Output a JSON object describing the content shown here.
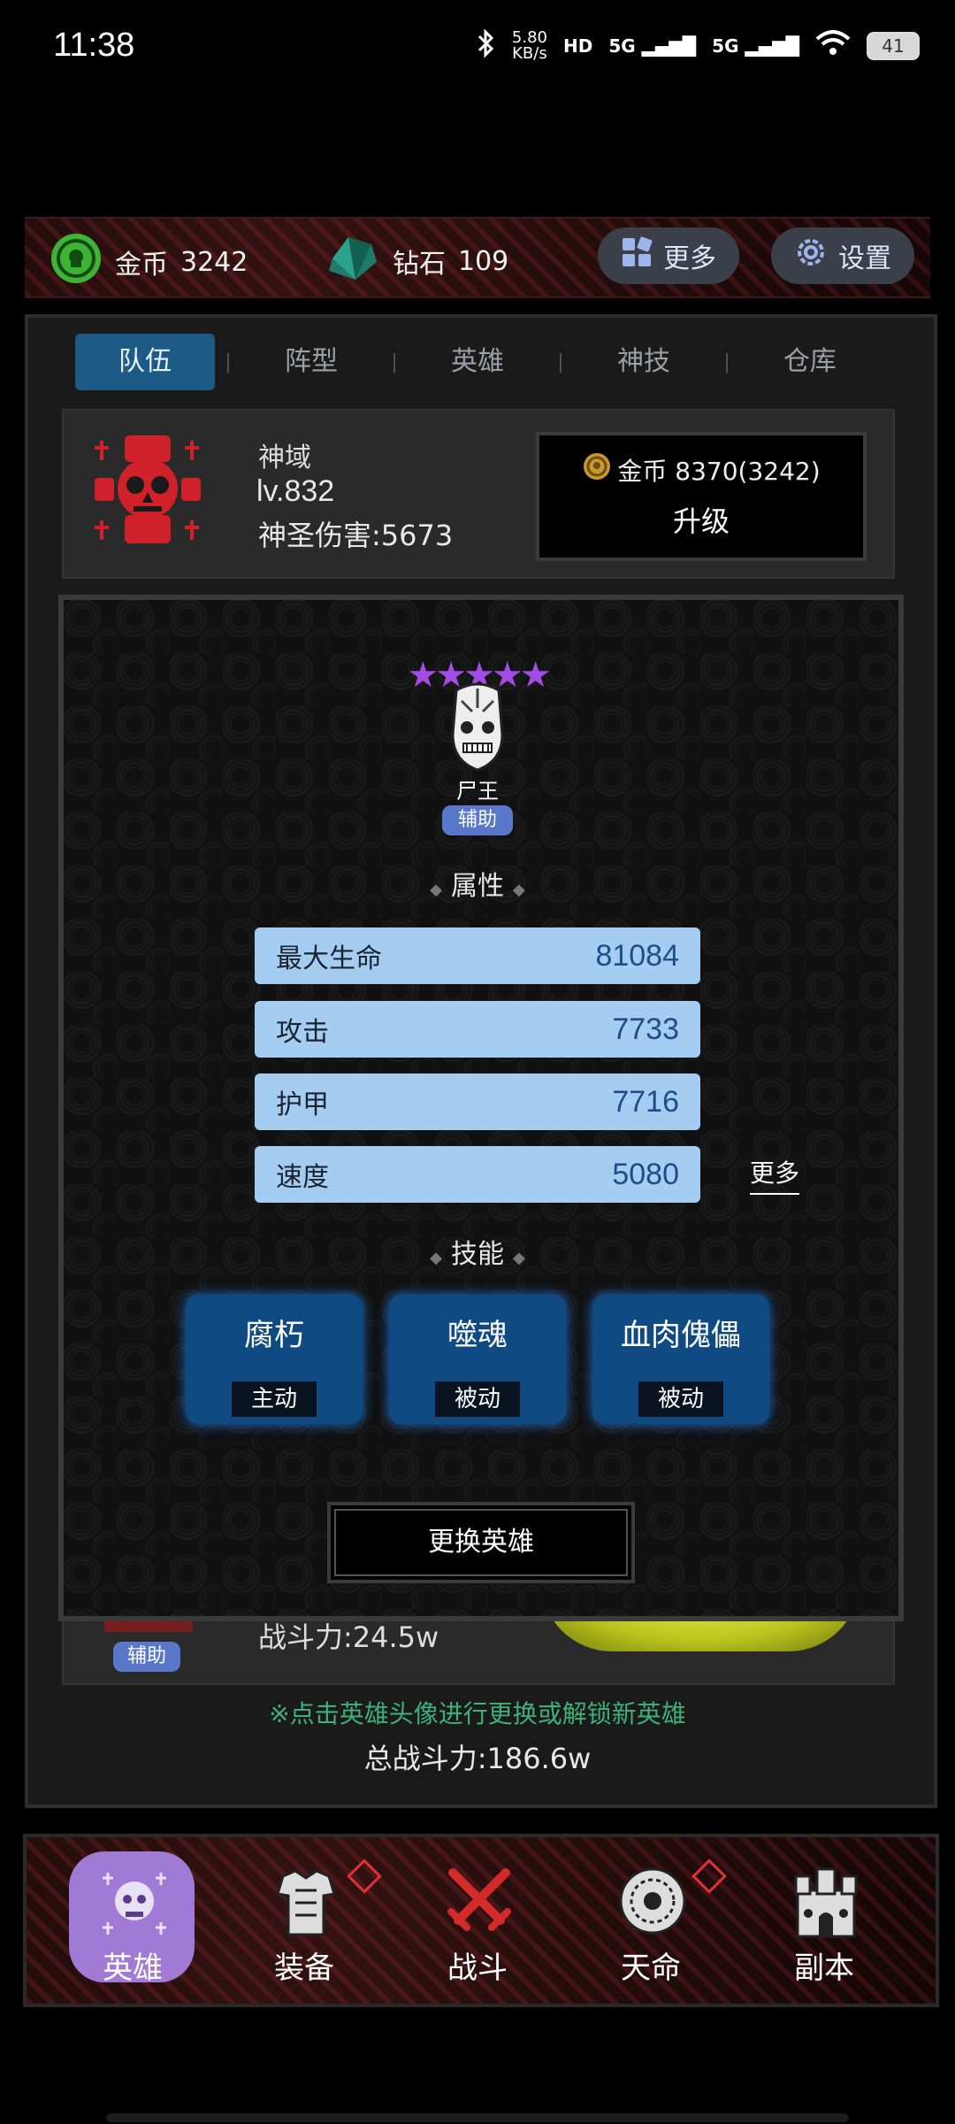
{
  "status_bar": {
    "time": "11:38",
    "net_speed_value": "5.80",
    "net_speed_unit": "KB/s",
    "hd_label": "HD",
    "sim1_label": "5G",
    "sim2_label": "5G",
    "battery": "41"
  },
  "resources": {
    "gold_label": "金币",
    "gold_value": "3242",
    "diamond_label": "钻石",
    "diamond_value": "109",
    "more_label": "更多",
    "settings_label": "设置"
  },
  "tabs": [
    {
      "label": "队伍",
      "active": true
    },
    {
      "label": "阵型",
      "active": false
    },
    {
      "label": "英雄",
      "active": false
    },
    {
      "label": "神技",
      "active": false
    },
    {
      "label": "仓库",
      "active": false
    }
  ],
  "domain": {
    "name": "神域",
    "level": "lv.832",
    "holy_damage": "神圣伤害:5673",
    "upgrade_cost": "金币 8370(3242)",
    "upgrade_label": "升级"
  },
  "hero": {
    "stars": "★★★★★",
    "star_count": 5,
    "name": "尸王",
    "role": "辅助",
    "attributes_title": "属性",
    "attributes": [
      {
        "label": "最大生命",
        "value": "81084"
      },
      {
        "label": "攻击",
        "value": "7733"
      },
      {
        "label": "护甲",
        "value": "7716"
      },
      {
        "label": "速度",
        "value": "5080"
      }
    ],
    "more_label": "更多",
    "skills_title": "技能",
    "skills": [
      {
        "name": "腐朽",
        "type": "主动"
      },
      {
        "name": "噬魂",
        "type": "被动"
      },
      {
        "name": "血肉傀儡",
        "type": "被动"
      }
    ],
    "change_hero_label": "更换英雄"
  },
  "behind_row": {
    "power": "战斗力:24.5w",
    "role": "辅助"
  },
  "hint": "※点击英雄头像进行更换或解锁新英雄",
  "total_power": "总战斗力:186.6w",
  "bottom_nav": [
    {
      "label": "英雄",
      "active": true
    },
    {
      "label": "装备",
      "active": false
    },
    {
      "label": "战斗",
      "active": false
    },
    {
      "label": "天命",
      "active": false
    },
    {
      "label": "副本",
      "active": false
    }
  ],
  "colors": {
    "tab_active": "#1d5b86",
    "stat_bg": "#a5cdf2",
    "skill_bg": "#0f4a82",
    "star": "#a24ce6",
    "hint": "#3fb07a",
    "nav_active": "#a17ad6"
  }
}
